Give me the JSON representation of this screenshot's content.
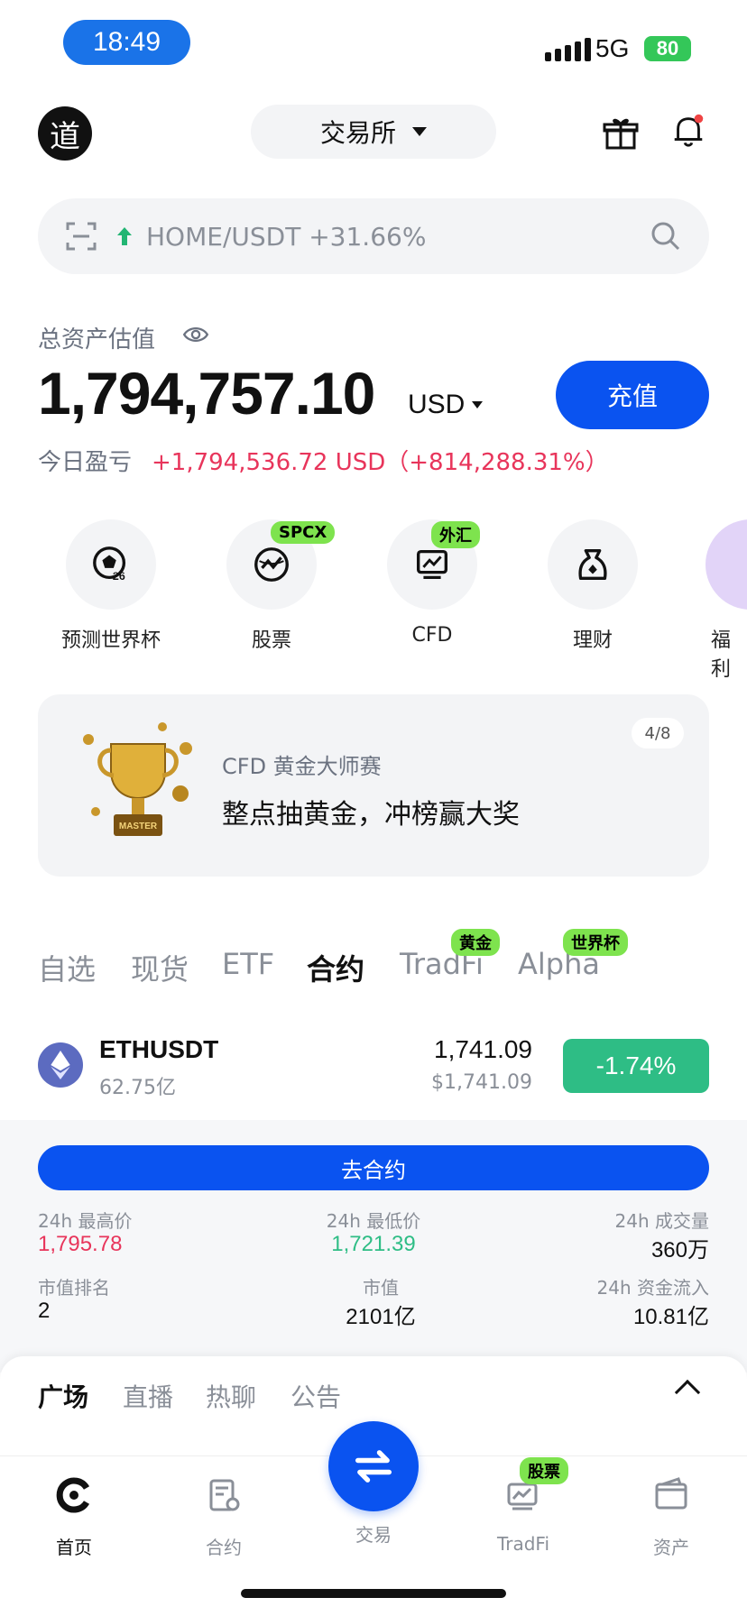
{
  "status_bar": {
    "time": "18:49",
    "network": "5G",
    "battery": "80"
  },
  "header": {
    "avatar_text": "道",
    "exchange_label": "交易所"
  },
  "search": {
    "ticker_text": "HOME/USDT +31.66%"
  },
  "balance": {
    "label": "总资产估值",
    "amount": "1,794,757.10",
    "currency": "USD",
    "deposit_label": "充值",
    "pnl_label": "今日盈亏",
    "pnl_value": "+1,794,536.72 USD（+814,288.31%）"
  },
  "shortcuts": [
    {
      "label": "预测世界杯",
      "tag": ""
    },
    {
      "label": "股票",
      "tag": "SPCX"
    },
    {
      "label": "CFD",
      "tag": "外汇"
    },
    {
      "label": "理财",
      "tag": ""
    },
    {
      "label": "福利",
      "tag": ""
    }
  ],
  "banner": {
    "counter": "4/8",
    "subtitle": "CFD 黄金大师赛",
    "title": "整点抽黄金，冲榜赢大奖"
  },
  "market_tabs": [
    {
      "label": "自选",
      "tag": ""
    },
    {
      "label": "现货",
      "tag": ""
    },
    {
      "label": "ETF",
      "tag": ""
    },
    {
      "label": "合约",
      "tag": ""
    },
    {
      "label": "TradFi",
      "tag": "黄金"
    },
    {
      "label": "Alpha",
      "tag": "世界杯"
    }
  ],
  "coin": {
    "symbol": "ETHUSDT",
    "market_cap": "62.75亿",
    "price": "1,741.09",
    "price_usd": "$1,741.09",
    "change": "-1.74%",
    "action_label": "去合约"
  },
  "stats": [
    {
      "label": "24h 最高价",
      "value": "1,795.78"
    },
    {
      "label": "24h 最低价",
      "value": "1,721.39"
    },
    {
      "label": "24h 成交量",
      "value": "360万"
    },
    {
      "label": "市值排名",
      "value": "2"
    },
    {
      "label": "市值",
      "value": "2101亿"
    },
    {
      "label": "24h 资金流入",
      "value": "10.81亿"
    }
  ],
  "social_tabs": [
    "广场",
    "直播",
    "热聊",
    "公告"
  ],
  "bottom_nav": [
    {
      "label": "首页"
    },
    {
      "label": "合约"
    },
    {
      "label": "交易"
    },
    {
      "label": "TradFi",
      "tag": "股票"
    },
    {
      "label": "资产"
    }
  ],
  "colors": {
    "accent": "#0a53f0",
    "up": "#2ebd85",
    "down": "#e8355b",
    "tag": "#7ee34e"
  }
}
